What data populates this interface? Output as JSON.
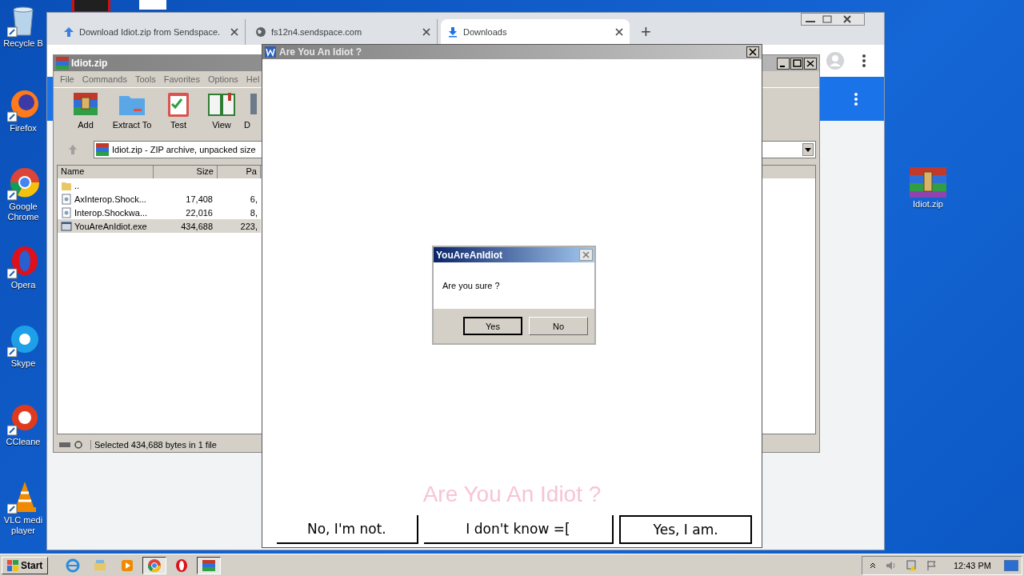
{
  "desktop_icons": [
    {
      "label": "Recycle B",
      "kind": "bin"
    },
    {
      "label": "Firefox",
      "kind": "firefox"
    },
    {
      "label": "Google Chrome",
      "kind": "chrome"
    },
    {
      "label": "Opera",
      "kind": "opera"
    },
    {
      "label": "Skype",
      "kind": "skype"
    },
    {
      "label": "CCleane",
      "kind": "ccleaner"
    },
    {
      "label": "VLC medi player",
      "kind": "vlc"
    }
  ],
  "desktop_right_icon": {
    "label": "Idiot.zip"
  },
  "browser": {
    "tabs": [
      {
        "title": "Download Idiot.zip from Sendspace.",
        "kind": "upload",
        "selected": false
      },
      {
        "title": "fs12n4.sendspace.com",
        "kind": "globe",
        "selected": false
      },
      {
        "title": "Downloads",
        "kind": "download",
        "selected": true
      }
    ],
    "new_tab": "+"
  },
  "winrar": {
    "title": "Idiot.zip",
    "menu": [
      "File",
      "Commands",
      "Tools",
      "Favorites",
      "Options",
      "Hel"
    ],
    "toolbar": [
      {
        "label": "Add",
        "kind": "archive"
      },
      {
        "label": "Extract To",
        "kind": "folder"
      },
      {
        "label": "Test",
        "kind": "clipboard"
      },
      {
        "label": "View",
        "kind": "book"
      },
      {
        "label": "D",
        "kind": "delete"
      }
    ],
    "address": "Idiot.zip - ZIP archive, unpacked size",
    "columns": [
      "Name",
      "Size",
      "Pa"
    ],
    "rows": [
      {
        "kind": "folder",
        "cells": [
          ".."
        ],
        "selected": false
      },
      {
        "kind": "dll",
        "cells": [
          "AxInterop.Shock...",
          "17,408",
          "6,"
        ],
        "selected": false
      },
      {
        "kind": "dll",
        "cells": [
          "Interop.Shockwa...",
          "22,016",
          "8,"
        ],
        "selected": false
      },
      {
        "kind": "exe",
        "cells": [
          "YouAreAnIdiot.exe",
          "434,688",
          "223,"
        ],
        "selected": true
      }
    ],
    "status": "Selected 434,688 bytes in 1 file"
  },
  "idiot_window": {
    "title": "Are You An Idiot ?",
    "heading": "Are You An Idiot ?",
    "buttons": [
      {
        "label": "No, I'm not.",
        "default": false
      },
      {
        "label": "I don't know =[",
        "default": false
      },
      {
        "label": "Yes, I am.",
        "default": true
      }
    ]
  },
  "dialog": {
    "title": "YouAreAnIdiot",
    "message": "Are you sure ?",
    "buttons": [
      {
        "label": "Yes",
        "default": true
      },
      {
        "label": "No",
        "default": false
      }
    ]
  },
  "taskbar": {
    "start": "Start",
    "apps": [
      {
        "kind": "ie",
        "active": false
      },
      {
        "kind": "explorer",
        "active": false
      },
      {
        "kind": "media",
        "active": false
      },
      {
        "kind": "chrome",
        "active": true
      },
      {
        "kind": "opera",
        "active": false
      },
      {
        "kind": "winrar",
        "active": true
      }
    ],
    "clock": "12:43 PM"
  }
}
